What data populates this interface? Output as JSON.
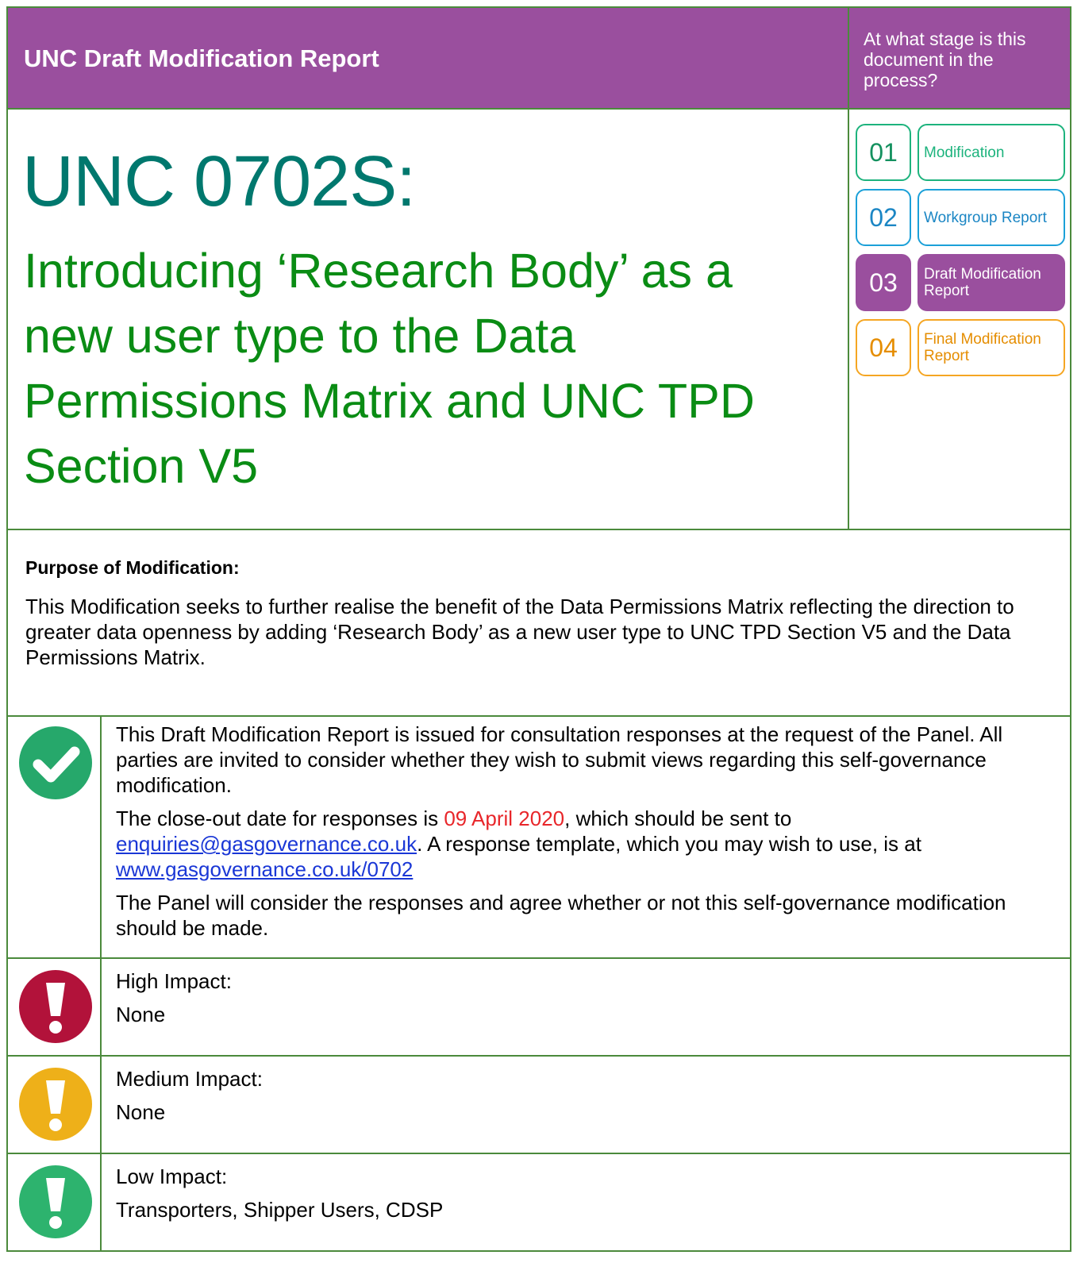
{
  "header": {
    "title": "UNC Draft Modification Report",
    "stage_question": "At what stage is this document in the process?"
  },
  "modification": {
    "id": "UNC 0702S:",
    "title": "Introducing ‘Research Body’ as a new user type to the Data Permissions Matrix and UNC TPD Section V5"
  },
  "stages": [
    {
      "number": "01",
      "label": "Modification",
      "color": "#1db37d"
    },
    {
      "number": "02",
      "label": "Workgroup Report",
      "color": "#1ba0d8"
    },
    {
      "number": "03",
      "label": "Draft Modification Report",
      "color": "#9a4f9e",
      "current": true
    },
    {
      "number": "04",
      "label": "Final Modification Report",
      "color": "#f5a623"
    }
  ],
  "purpose": {
    "heading": "Purpose of Modification:",
    "text": "This Modification seeks to further realise the benefit of the Data Permissions Matrix reflecting the direction to greater data openness by adding ‘Research Body’ as a new user type to UNC TPD Section V5 and the Data Permissions Matrix."
  },
  "consultation": {
    "icon": "checkmark-icon",
    "para1": "This Draft Modification Report is issued for consultation responses at the request of the Panel. All parties are invited to consider whether they wish to submit views regarding this self-governance modification.",
    "para2_prefix": "The close-out date for responses is ",
    "close_date": "09 April 2020",
    "para2_mid": ", which should be sent to ",
    "email": "enquiries@gasgovernance.co.uk",
    "para2_after_email": ".  A response template, which you may wish to use, is at ",
    "template_url": "www.gasgovernance.co.uk/0702",
    "para3": "The Panel will consider the responses and agree whether or not this self-governance modification should be made."
  },
  "impacts": [
    {
      "level": "High Impact:",
      "value": "None",
      "color": "#b2123a",
      "icon": "exclamation-icon"
    },
    {
      "level": "Medium Impact:",
      "value": "None",
      "color": "#eeb019",
      "icon": "exclamation-icon"
    },
    {
      "level": "Low Impact:",
      "value": "Transporters, Shipper Users, CDSP",
      "color": "#2db36e",
      "icon": "exclamation-icon"
    }
  ]
}
